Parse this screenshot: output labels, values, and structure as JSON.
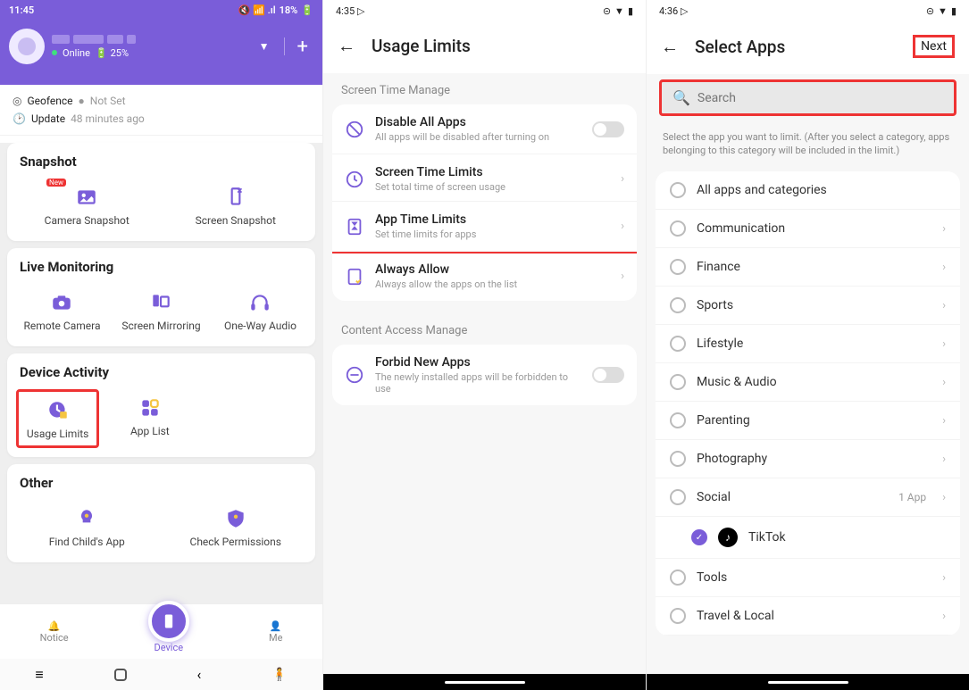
{
  "screen1": {
    "status": {
      "time": "11:45",
      "battery": "18%"
    },
    "profile": {
      "online": "Online",
      "battery": "25%"
    },
    "info": {
      "geofence_lbl": "Geofence",
      "geofence_val": "Not Set",
      "update_lbl": "Update",
      "update_val": "48 minutes ago"
    },
    "snapshot": {
      "title": "Snapshot",
      "camera": "Camera Snapshot",
      "screen": "Screen Snapshot"
    },
    "live": {
      "title": "Live Monitoring",
      "remote": "Remote Camera",
      "mirror": "Screen Mirroring",
      "audio": "One-Way Audio"
    },
    "device": {
      "title": "Device Activity",
      "usage": "Usage Limits",
      "applist": "App List"
    },
    "other": {
      "title": "Other",
      "find": "Find Child's App",
      "perms": "Check Permissions"
    },
    "nav": {
      "notice": "Notice",
      "device": "Device",
      "me": "Me"
    }
  },
  "screen2": {
    "status": {
      "time": "4:35"
    },
    "title": "Usage Limits",
    "sec1": "Screen Time Manage",
    "rows": {
      "disable_t": "Disable All Apps",
      "disable_s": "All apps will be disabled after turning on",
      "screen_t": "Screen Time Limits",
      "screen_s": "Set total time of screen usage",
      "app_t": "App Time Limits",
      "app_s": "Set time limits for apps",
      "allow_t": "Always Allow",
      "allow_s": "Always allow the apps on the list"
    },
    "sec2": "Content Access Manage",
    "forbid_t": "Forbid New Apps",
    "forbid_s": "The newly installed apps will be forbidden to use"
  },
  "screen3": {
    "status": {
      "time": "4:36"
    },
    "title": "Select Apps",
    "next": "Next",
    "search_ph": "Search",
    "hint": "Select the app you want to limit. (After you select a category, apps belonging to this category will be included in the limit.)",
    "cats": {
      "all": "All apps and categories",
      "comm": "Communication",
      "fin": "Finance",
      "sports": "Sports",
      "life": "Lifestyle",
      "music": "Music & Audio",
      "parent": "Parenting",
      "photo": "Photography",
      "social": "Social",
      "social_meta": "1 App",
      "tiktok": "TikTok",
      "tools": "Tools",
      "travel": "Travel & Local"
    }
  }
}
